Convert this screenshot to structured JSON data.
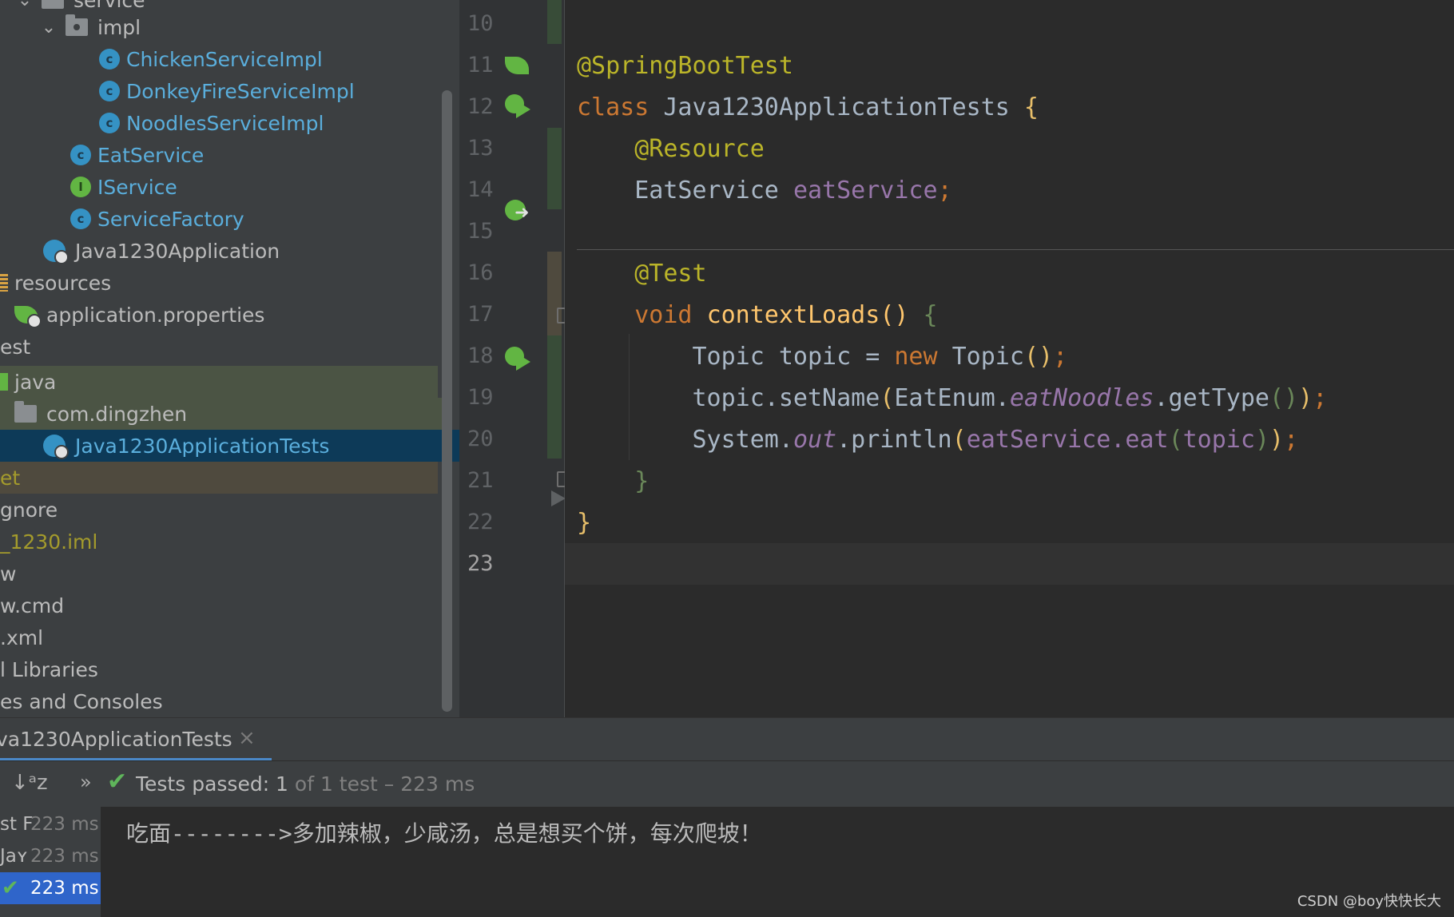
{
  "project_tree": {
    "rows": [
      {
        "label": "service",
        "indent": "chevron-open-folder-dot"
      },
      {
        "label": "impl"
      },
      {
        "label": "ChickenServiceImpl",
        "icon": "class-icon"
      },
      {
        "label": "DonkeyFireServiceImpl",
        "icon": "class-icon"
      },
      {
        "label": "NoodlesServiceImpl",
        "icon": "class-icon"
      },
      {
        "label": "EatService",
        "icon": "class-icon"
      },
      {
        "label": "IService",
        "icon": "interface-icon"
      },
      {
        "label": "ServiceFactory",
        "icon": "class-icon"
      },
      {
        "label": "Java1230Application",
        "icon": "spring-app-icon"
      },
      {
        "label": "resources",
        "icon": "resources-folder-icon"
      },
      {
        "label": "application.properties",
        "icon": "spring-properties-icon"
      },
      {
        "label": "est"
      },
      {
        "label": "java",
        "icon": "test-source-folder-icon"
      },
      {
        "label": "com.dingzhen",
        "icon": "package-folder-icon"
      },
      {
        "label": "Java1230ApplicationTests",
        "icon": "spring-test-class-icon"
      },
      {
        "label": "et"
      },
      {
        "label": "gnore"
      },
      {
        "label": "_1230.iml"
      },
      {
        "label": "w"
      },
      {
        "label": "w.cmd"
      },
      {
        "label": ".xml"
      },
      {
        "label": "l Libraries"
      },
      {
        "label": "es and Consoles"
      }
    ]
  },
  "editor": {
    "line_numbers": [
      "10",
      "11",
      "12",
      "13",
      "14",
      "15",
      "16",
      "17",
      "18",
      "19",
      "20",
      "21",
      "22",
      "23"
    ],
    "current_line": "23",
    "code": {
      "l11": {
        "ann": "@SpringBootTest"
      },
      "l12": {
        "kw": "class",
        "name": "Java1230ApplicationTests",
        "brace": "{"
      },
      "l13": {
        "ann": "@Resource"
      },
      "l14": {
        "type": "EatService",
        "field": "eatService",
        "semi": ";"
      },
      "l16": {
        "ann": "@Test"
      },
      "l17": {
        "kw": "void",
        "fn": "contextLoads",
        "parens": "()",
        "brace": "{"
      },
      "l18": {
        "a": "Topic topic = ",
        "kw": "new",
        "b": " Topic",
        "parens": "()",
        "semi": ";"
      },
      "l19": {
        "a": "topic.setName",
        "p1o": "(",
        "b": "EatEnum.",
        "it": "eatNoodles",
        "c": ".getType",
        "p2": "()",
        "p1c": ")",
        "semi": ";"
      },
      "l20": {
        "a": "System.",
        "it": "out",
        "b": ".println",
        "p1o": "(",
        "c": "eatService.eat",
        "p2o": "(",
        "d": "topic",
        "p2c": ")",
        "p1c": ")",
        "semi": ";"
      },
      "l21": {
        "brace": "}"
      },
      "l22": {
        "brace": "}"
      }
    }
  },
  "run_panel": {
    "tab_label": "va1230ApplicationTests",
    "tab_close": "×",
    "sort_icon": "↓ᵃz",
    "more_icon": "»",
    "status_check": "✔",
    "status_bold": "Tests passed: 1",
    "status_rest": " of 1 test – 223 ms",
    "test_tree": [
      {
        "name": "st F",
        "time": "223 ms"
      },
      {
        "name": "Jaʏ",
        "time": "223 ms"
      },
      {
        "name": "",
        "time": "223 ms",
        "passed_icon": "✔"
      }
    ],
    "console_output": "吃面-------->多加辣椒，少咸汤，总是想买个饼，每次爬坡！",
    "watermark": "CSDN @boy快快长大"
  },
  "colors": {
    "keyword": "#cc7832",
    "annotation": "#bbb529",
    "method": "#ffc66d",
    "field": "#9876aa",
    "passed": "#5fb55b",
    "selection": "#0d3a58"
  }
}
